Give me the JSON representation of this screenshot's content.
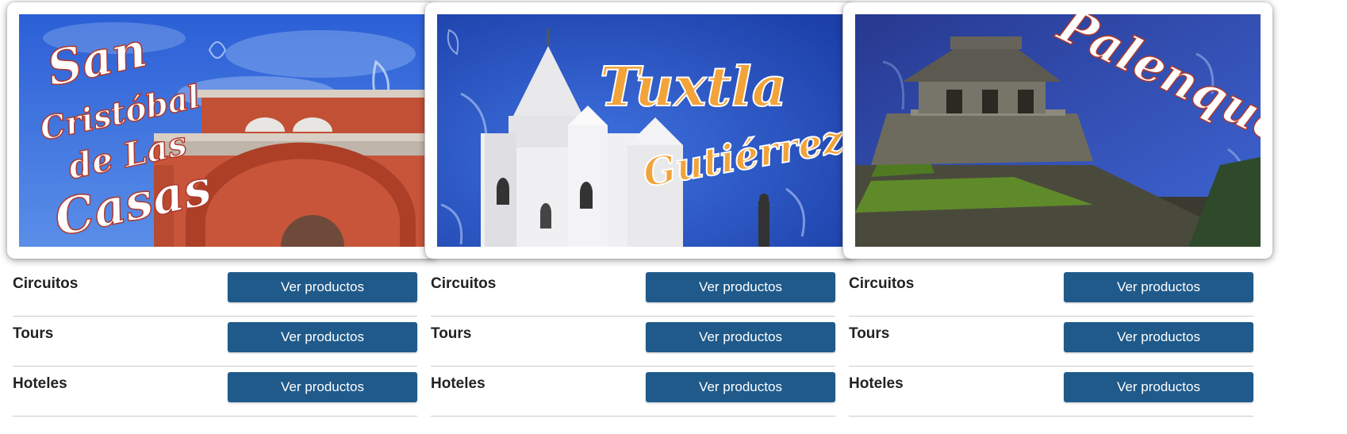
{
  "cards": [
    {
      "banner_title_lines": [
        "San",
        "Cristóbal",
        "de Las",
        "Casas"
      ],
      "rows": [
        {
          "label": "Circuitos",
          "button": "Ver productos"
        },
        {
          "label": "Tours",
          "button": "Ver productos"
        },
        {
          "label": "Hoteles",
          "button": "Ver productos"
        }
      ]
    },
    {
      "banner_title_lines": [
        "Tuxtla",
        "Gutiérrez"
      ],
      "rows": [
        {
          "label": "Circuitos",
          "button": "Ver productos"
        },
        {
          "label": "Tours",
          "button": "Ver productos"
        },
        {
          "label": "Hoteles",
          "button": "Ver productos"
        }
      ]
    },
    {
      "banner_title_lines": [
        "Palenque"
      ],
      "rows": [
        {
          "label": "Circuitos",
          "button": "Ver productos"
        },
        {
          "label": "Tours",
          "button": "Ver productos"
        },
        {
          "label": "Hoteles",
          "button": "Ver productos"
        }
      ]
    }
  ],
  "colors": {
    "button_bg": "#1f5a8a",
    "sky_blue": "#2a56c8",
    "title_orange": "#f2a33a",
    "title_shadow_red": "#b0392b"
  }
}
